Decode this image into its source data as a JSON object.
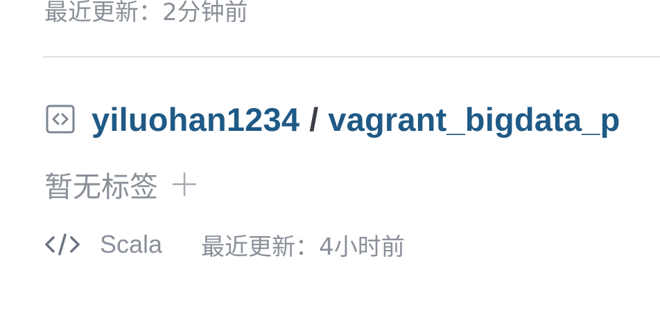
{
  "previous_item": {
    "updated_text": "最近更新：2分钟前"
  },
  "repo": {
    "owner": "yiluohan1234",
    "separator": "/",
    "name": "vagrant_bigdata_p",
    "icon": "repo-code-icon",
    "tags_empty_text": "暂无标签",
    "add_tag_icon": "plus-icon",
    "language_icon": "code-icon",
    "language": "Scala",
    "updated_text": "最近更新：4小时前"
  },
  "colors": {
    "link": "#1f5a86",
    "muted": "#8a9099",
    "divider": "#dde3ea"
  }
}
